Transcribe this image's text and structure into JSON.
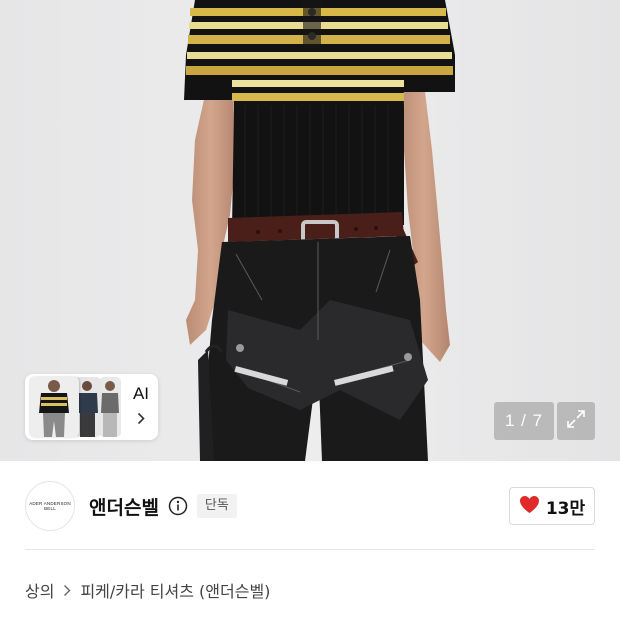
{
  "gallery": {
    "ai_label": "AI",
    "counter": "1 / 7",
    "icons": {
      "ai_more": "chevron-right-icon",
      "expand": "expand-icon"
    }
  },
  "brand": {
    "logo_text": "ADER ANDERSON BELL",
    "name": "앤더슨벨",
    "badge": "단독",
    "icons": {
      "info": "info-icon"
    }
  },
  "like": {
    "count": "13만",
    "icon": "heart-icon",
    "color": "#e02a2a"
  },
  "breadcrumb": {
    "items": [
      "상의",
      "피케/카라 티셔츠 (앤더슨벨)"
    ],
    "separator_icon": "chevron-right-icon"
  }
}
